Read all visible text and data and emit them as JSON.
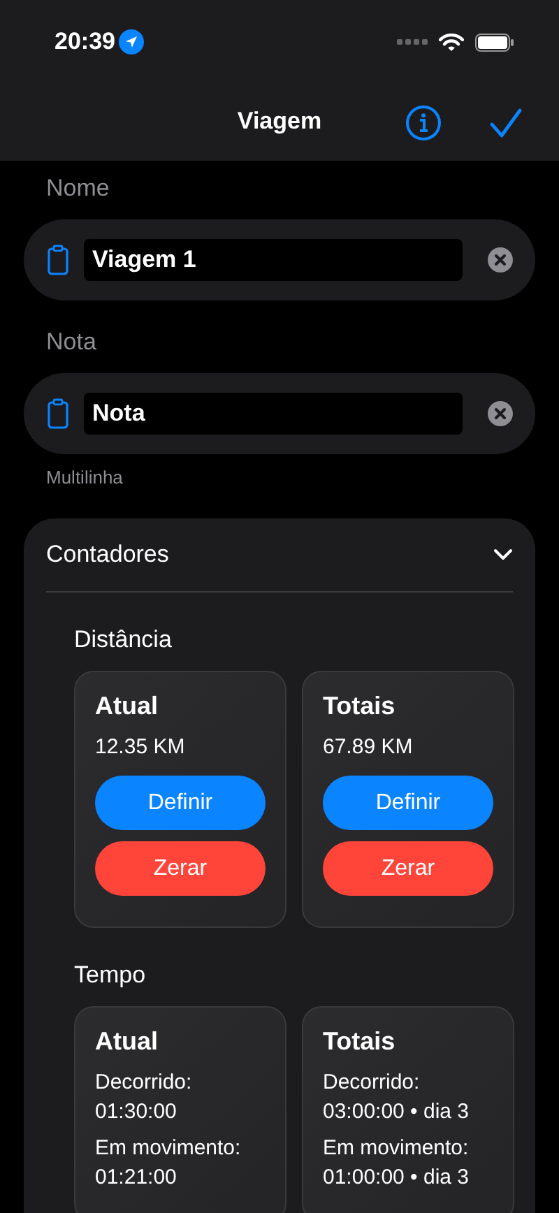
{
  "status_bar": {
    "time": "20:39"
  },
  "nav": {
    "title": "Viagem"
  },
  "fields": [
    {
      "label": "Nome",
      "value": "Viagem 1"
    },
    {
      "label": "Nota",
      "value": "Nota",
      "footnote": "Multilinha"
    }
  ],
  "counters": {
    "title": "Contadores",
    "expanded": true,
    "sections": [
      {
        "title": "Distância",
        "kind": "distance",
        "cards": [
          {
            "title": "Atual",
            "reading": "12.35 KM",
            "buttons": [
              {
                "label": "Definir",
                "kind": "primary"
              },
              {
                "label": "Zerar",
                "kind": "destructive"
              }
            ]
          },
          {
            "title": "Totais",
            "reading": "67.89 KM",
            "buttons": [
              {
                "label": "Definir",
                "kind": "primary"
              },
              {
                "label": "Zerar",
                "kind": "destructive"
              }
            ]
          }
        ]
      },
      {
        "title": "Tempo",
        "kind": "time",
        "cards": [
          {
            "title": "Atual",
            "rows": [
              {
                "label": "Decorrido:",
                "value": "01:30:00"
              },
              {
                "label": "Em movimento:",
                "value": "01:21:00"
              }
            ]
          },
          {
            "title": "Totais",
            "rows": [
              {
                "label": "Decorrido:",
                "value": "03:00:00 • dia 3"
              },
              {
                "label": "Em movimento:",
                "value": "01:00:00 • dia 3"
              }
            ]
          }
        ]
      }
    ]
  }
}
